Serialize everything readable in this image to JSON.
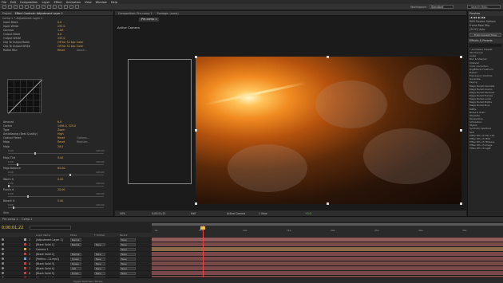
{
  "menu": [
    "File",
    "Edit",
    "Composition",
    "Layer",
    "Effect",
    "Animation",
    "View",
    "Window",
    "Help"
  ],
  "toolbar": {
    "workspace_label": "Workspace:",
    "workspace_value": "Standard",
    "search_placeholder": "Search Help"
  },
  "effect_controls": {
    "tabs": [
      "Project",
      "Effect Controls: Adjustment Layer 1"
    ],
    "breadcrumb": "Comp 1 • Adjustment Layer 1",
    "levels_rows": [
      {
        "label": "Input Black",
        "value": "0.0"
      },
      {
        "label": "Input White",
        "value": "255.0"
      },
      {
        "label": "Gamma",
        "value": "1.00"
      },
      {
        "label": "Output Black",
        "value": "0.0"
      },
      {
        "label": "Output White",
        "value": "255.0"
      },
      {
        "label": "Clip To Output Black",
        "value": "Off for 32 bpc Color"
      },
      {
        "label": "Clip To Output White",
        "value": "Off for 32 bpc Color"
      },
      {
        "label": "Radial Blur",
        "value": "Reset",
        "extra": "About..."
      }
    ],
    "optical_rows": [
      {
        "label": "Amount",
        "value": "6.0"
      },
      {
        "label": "Center",
        "value": "1496.0, 325.0"
      },
      {
        "label": "Type",
        "value": "Zoom"
      },
      {
        "label": "Antialiasing (Best Quality)",
        "value": "High"
      },
      {
        "label": "Optical Flares",
        "value": "Reset",
        "extra": "Options..."
      },
      {
        "label": "Mojo",
        "value": "Reset",
        "extra": "Register..."
      }
    ],
    "mojo_rows": [
      {
        "label": "Mojo",
        "value": "28.0",
        "min": "0.00",
        "max": "100.00",
        "level": 0.28
      },
      {
        "label": "Mojo Tint",
        "value": "9.00",
        "min": "0.00",
        "max": "100.00",
        "level": 0.09
      },
      {
        "label": "Mojo Balance",
        "value": "65.00",
        "min": "0.00",
        "max": "100.00",
        "level": 0.65
      },
      {
        "label": "Warm It",
        "value": "0.00",
        "min": "0.00",
        "max": "100.00",
        "level": 0.0
      },
      {
        "label": "Punch It",
        "value": "20.00",
        "min": "0.00",
        "max": "100.00",
        "level": 0.2
      },
      {
        "label": "Bleach It",
        "value": "5.00",
        "min": "0.00",
        "max": "100.00",
        "level": 0.05
      }
    ],
    "skin_label": "Skin"
  },
  "composition": {
    "tabs": [
      "Composition: Pre-comp 1",
      "Footage: (none)"
    ],
    "subtab": "Pre-comp 1",
    "view_label": "Active Camera",
    "viewer_bar": {
      "zoom": "50%",
      "timecode": "0;00;01;22",
      "resolution": "Half",
      "camera": "Active Camera",
      "views": "1 View",
      "exposure": "+0.0"
    }
  },
  "right_panel": {
    "preview_title": "Preview",
    "ram_options": "RAM Preview Options",
    "frame_rate_label": "Frame Rate",
    "frame_rate_value": "(29.97)",
    "skip_label": "Skip",
    "resolution_value": "Auto",
    "from_current": "From Current Time",
    "effects_title": "Effects & Presets",
    "effects": [
      "* Animation Presets",
      "3D Channel",
      "Audio",
      "Blur & Sharpen",
      "Channel",
      "Color Correction",
      "DigiEffects FreeForm",
      "Distort",
      "Expression Controls",
      "Generate",
      "Keying",
      "Magic Bullet Colorista",
      "Magic Bullet Cosmo",
      "Magic Bullet Denoiser",
      "Magic Bullet Frames",
      "Magic Bullet Looks",
      "Magic Bullet Misfire",
      "Magic Bullet Mojo",
      "Matte",
      "Noise & Grain",
      "Obsolete",
      "Perspective",
      "Simulation",
      "Stylize",
      "Synthetic Aperture",
      "Text",
      "Tiffen Dfx v3 Film Lab",
      "Tiffen Dfx v3 HDR",
      "Tiffen Dfx v3 HD/Lens",
      "Tiffen Dfx v3 Image",
      "Tiffen Dfx v3 Light"
    ]
  },
  "timeline": {
    "tabs": [
      "Pre-comp 1",
      "Comp 1"
    ],
    "timecode": "0;00;01;22",
    "columns": [
      "Layer Name",
      "Mode",
      "T TrkMat",
      "Parent"
    ],
    "layers": [
      {
        "num": "1",
        "name": "[Adjustment Layer 1]",
        "mode": "Normal",
        "trk": "",
        "parent": "None",
        "color": "#a6a6a6",
        "bar": "#8f5b5b"
      },
      {
        "num": "2",
        "name": "[Black Solid 1]",
        "mode": "Normal",
        "trk": "None",
        "parent": "None",
        "color": "#b34a4a",
        "bar": "#7a4a4a"
      },
      {
        "num": "3",
        "name": "Camera 1",
        "mode": "",
        "trk": "",
        "parent": "None",
        "color": "#c9a64a",
        "bar": "#8a6a4a"
      },
      {
        "num": "4",
        "name": "[Black Solid 2]",
        "mode": "Normal",
        "trk": "None",
        "parent": "None",
        "color": "#b34a4a",
        "bar": "#7a4a4a"
      },
      {
        "num": "5",
        "name": "[Particu...11.mp4]",
        "mode": "Screen",
        "trk": "None",
        "parent": "None",
        "color": "#7a9ec9",
        "bar": "#7a4a4a"
      },
      {
        "num": "6",
        "name": "[Black Solid 3]",
        "mode": "Screen",
        "trk": "None",
        "parent": "None",
        "color": "#b34a4a",
        "bar": "#7a4a4a"
      },
      {
        "num": "7",
        "name": "[Black Solid 4]",
        "mode": "Add",
        "trk": "None",
        "parent": "None",
        "color": "#b34a4a",
        "bar": "#7a4a4a"
      },
      {
        "num": "8",
        "name": "[Black Solid 5]",
        "mode": "Screen",
        "trk": "None",
        "parent": "None",
        "color": "#b34a4a",
        "bar": "#7a4a4a"
      },
      {
        "num": "9",
        "name": "[Black Solid 6]",
        "mode": "Screen",
        "trk": "None",
        "parent": "None",
        "color": "#b34a4a",
        "bar": "#7a4a4a"
      }
    ],
    "ruler_ticks": [
      "0s",
      "05s",
      "10s",
      "15s",
      "20s",
      "25s",
      "30s",
      "35s",
      "40s"
    ],
    "footer": "Toggle Switches / Modes"
  },
  "colors": {
    "value_orange": "#d9a14a",
    "timecode_yellow": "#e8c44a",
    "playhead_red": "#e44444"
  }
}
